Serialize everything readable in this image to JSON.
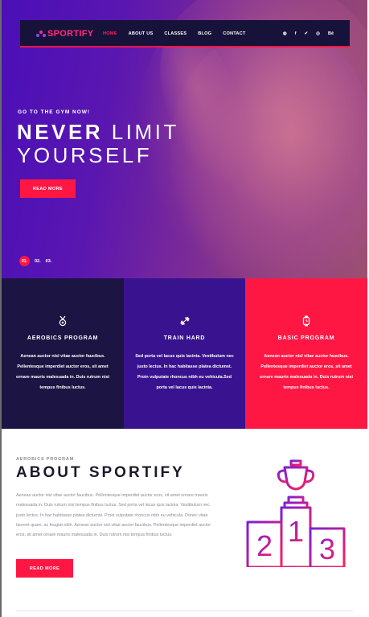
{
  "colors": {
    "accent": "#ff1744",
    "nav_bg": "#17123a",
    "card_dark": "#1c1442",
    "card_purple": "#38128f",
    "icon_grad_start": "#7b1fd8",
    "icon_grad_end": "#ff1f5a"
  },
  "nav": {
    "logo": "SPORTIFY",
    "items": [
      "HOME",
      "ABOUT US",
      "CLASSES",
      "BLOG",
      "CONTACT"
    ],
    "active_index": 0,
    "socials": [
      {
        "icon": "dribbble-icon",
        "glyph": "◍"
      },
      {
        "icon": "facebook-icon",
        "glyph": "f"
      },
      {
        "icon": "twitter-icon",
        "glyph": "✔"
      },
      {
        "icon": "pinterest-icon",
        "glyph": "◎"
      },
      {
        "icon": "behance-icon",
        "glyph": "Bē"
      }
    ]
  },
  "hero": {
    "subtitle": "GO TO THE GYM NOW!",
    "headline_bold": "NEVER",
    "headline_rest": " LIMIT",
    "headline_line2": "YOURSELF",
    "button": "READ MORE",
    "slides": [
      "01.",
      "02.",
      "03."
    ]
  },
  "features": [
    {
      "icon": "medal-icon",
      "title": "AEROBICS PROGRAM",
      "desc": "Aenean auctor nisl vitae auctor faucibus. Pellentesque imperdiet auctor eros, sit amet ornare mauris malesuada in. Duis rutrum nisi tempus finibus luctus."
    },
    {
      "icon": "dumbbell-icon",
      "title": "TRAIN HARD",
      "desc": "Sed porta vel lacus quis lacinia. Vestibulum nec justo lectus. In hac habitasse platea dictumst. Proin vulputate rhoncus nibh eu vehicula.Sed porta vel lacus quis lacinia."
    },
    {
      "icon": "smartwatch-icon",
      "title": "BASIC PROGRAM",
      "desc": "Aenean auctor nisl vitae auctor faucibus. Pellentesque imperdiet auctor eros, sit amet ornare mauris malesuada in. Duis rutrum nisi tempus finibus luctus."
    }
  ],
  "about": {
    "kicker": "AEROBICS PROGRAM",
    "title": "ABOUT SPORTIFY",
    "body": "Aenean auctor nisl vitae auctor faucibus. Pellentesque imperdiet auctor eros, sit amet ornare mauris malesuada in. Duis rutrum nisi tempus finibus luctus. Sed porta vel lacus quis lacinia. Vestibulum nec justo lectus. In hac habitasse platea dictumst. Proin vulputate rhoncus nibh eu vehicula. Donec vitae laoreet quam, ac feugiat nibh. Aenean auctor nisl vitae auctor faucibus. Pellentesque imperdiet auctor eros, sit amet ornare mauris malesuada in. Duis rutrum nisi tempus finibus luctus.",
    "button": "READ MORE",
    "podium": {
      "icon": "trophy-podium-icon",
      "places": [
        "2",
        "1",
        "3"
      ]
    }
  }
}
